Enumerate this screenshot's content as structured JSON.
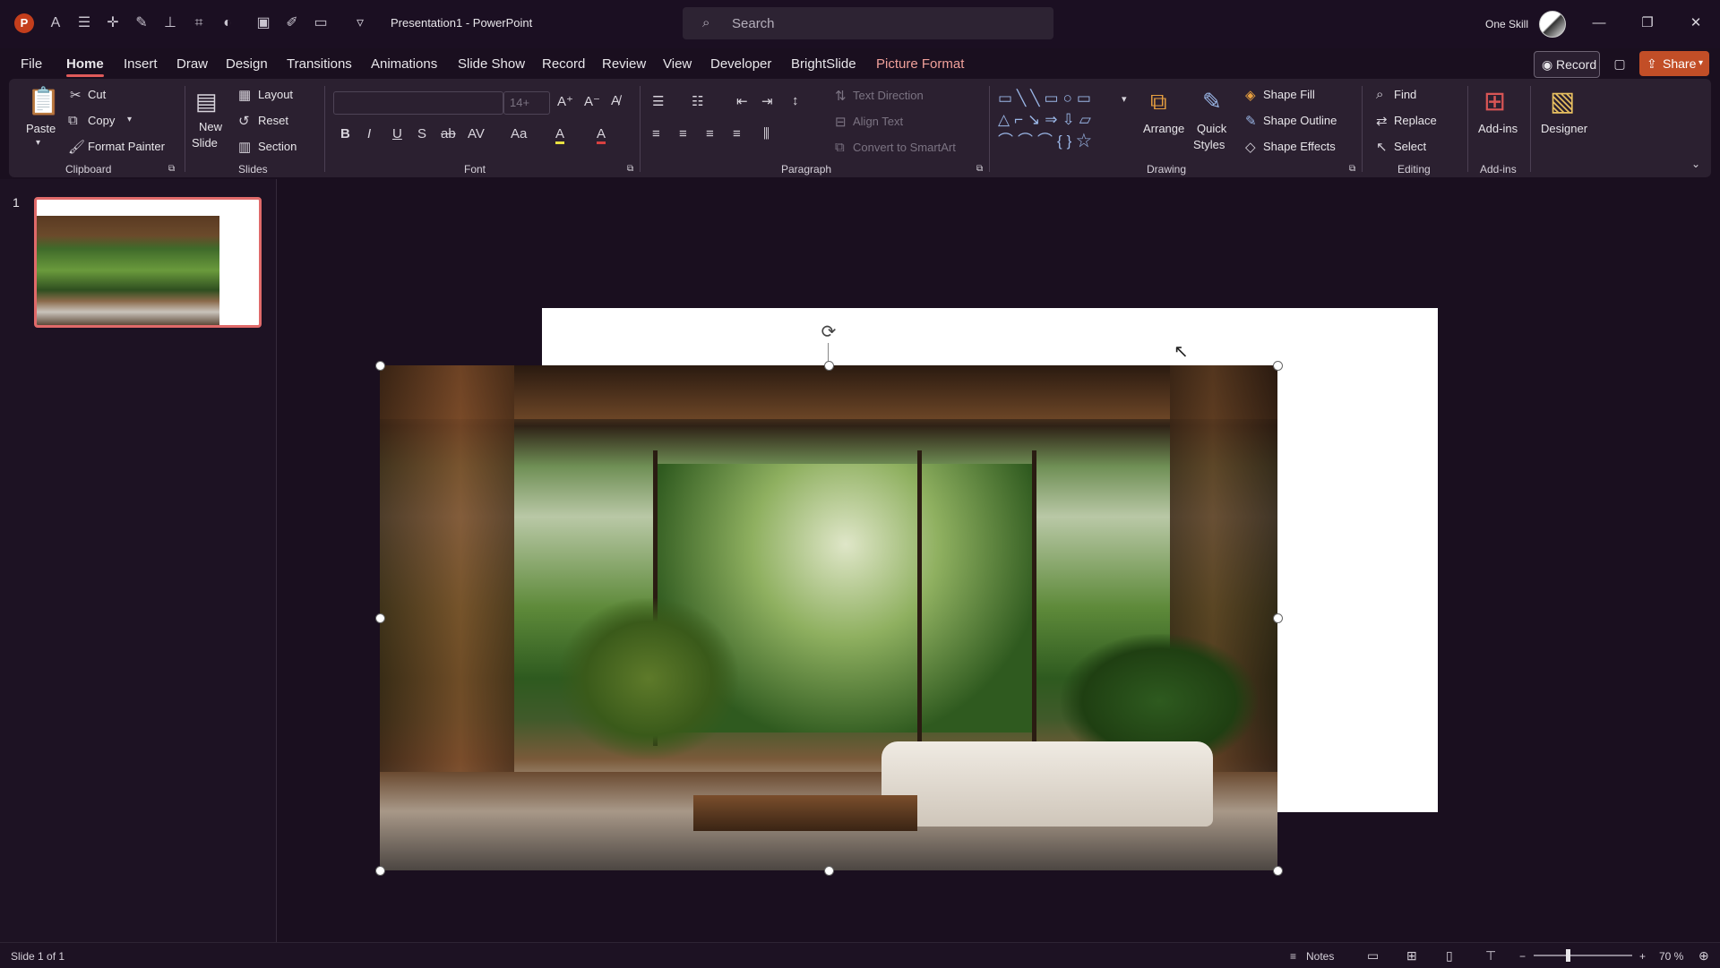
{
  "title_bar": {
    "doc_title": "Presentation1  -  PowerPoint",
    "search_placeholder": "Search",
    "user_name": "One Skill",
    "app_logo": "P"
  },
  "menu": {
    "tabs": [
      "File",
      "Home",
      "Insert",
      "Draw",
      "Design",
      "Transitions",
      "Animations",
      "Slide Show",
      "Record",
      "Review",
      "View",
      "Developer",
      "BrightSlide",
      "Picture Format"
    ],
    "record_label": "Record",
    "share_label": "Share"
  },
  "ribbon": {
    "clipboard": {
      "paste": "Paste",
      "cut": "Cut",
      "copy": "Copy",
      "format_painter": "Format Painter",
      "label": "Clipboard"
    },
    "slides": {
      "new_slide": "New",
      "new_slide2": "Slide",
      "layout": "Layout",
      "reset": "Reset",
      "section": "Section",
      "label": "Slides"
    },
    "font": {
      "name": "",
      "size": "14+",
      "bold": "B",
      "italic": "I",
      "underline": "U",
      "shadow": "S",
      "strike": "ab",
      "spacing": "AV",
      "case": "Aa",
      "highlight": "A",
      "color": "A",
      "label": "Font"
    },
    "paragraph": {
      "text_direction": "Text Direction",
      "align_text": "Align Text",
      "convert_smartart": "Convert to SmartArt",
      "label": "Paragraph"
    },
    "drawing": {
      "arrange": "Arrange",
      "quick": "Quick",
      "styles": "Styles",
      "shape_fill": "Shape Fill",
      "shape_outline": "Shape Outline",
      "shape_effects": "Shape Effects",
      "label": "Drawing"
    },
    "editing": {
      "find": "Find",
      "replace": "Replace",
      "select": "Select",
      "label": "Editing"
    },
    "addins": {
      "addins": "Add-ins",
      "label": "Add-ins"
    },
    "designer": {
      "label": "Designer"
    }
  },
  "thumbnails": {
    "slide_number": "1"
  },
  "status": {
    "slide_info": "Slide 1 of 1",
    "notes": "Notes",
    "zoom": "70 %",
    "zoom_level": 0.7
  },
  "colors": {
    "accent": "#e05a5a",
    "share": "#c24e27",
    "background": "#1a0f1f"
  }
}
